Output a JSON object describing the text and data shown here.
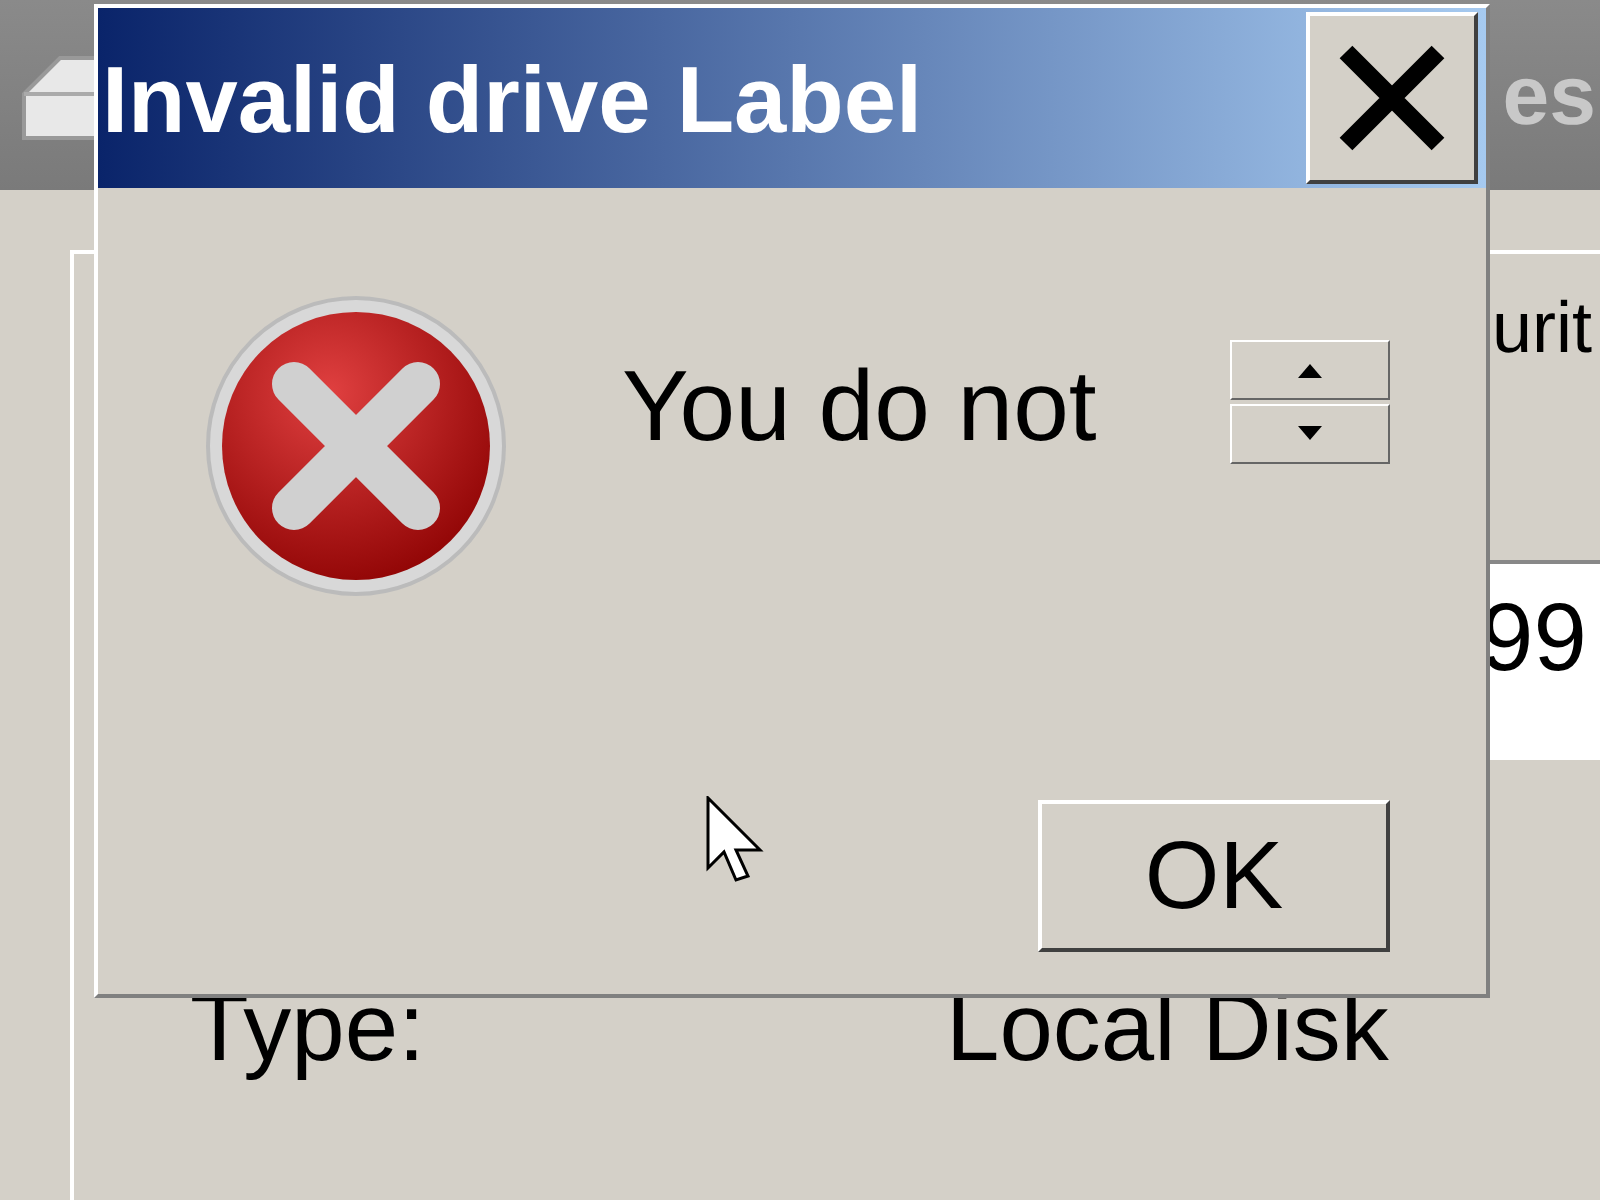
{
  "background_window": {
    "title": "es",
    "tab": "urit",
    "field_value": "99",
    "properties": [
      {
        "label": "Type:",
        "value": "Local Disk"
      }
    ]
  },
  "dialog": {
    "title": "Invalid drive Label",
    "message": "You do not",
    "buttons": [
      "OK"
    ]
  }
}
